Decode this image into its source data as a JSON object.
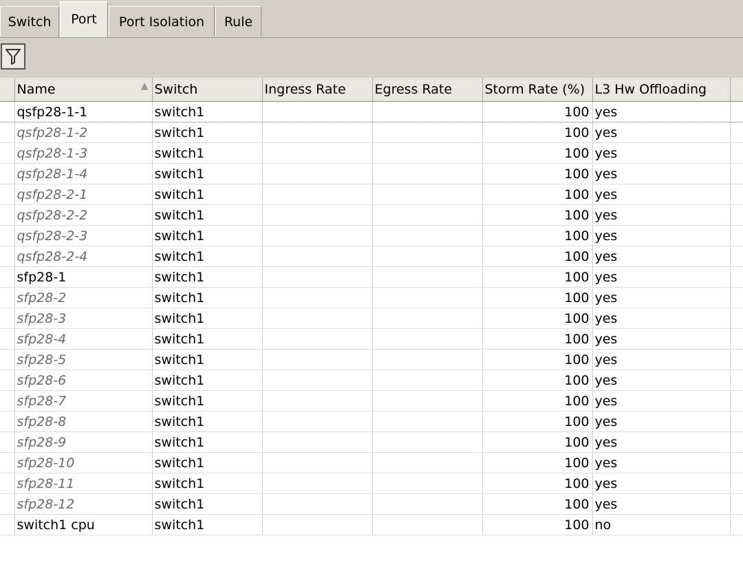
{
  "tabs": [
    {
      "label": "Switch",
      "active": false
    },
    {
      "label": "Port",
      "active": true
    },
    {
      "label": "Port Isolation",
      "active": false
    },
    {
      "label": "Rule",
      "active": false
    }
  ],
  "toolbar": {
    "filter_icon": "filter-icon"
  },
  "table": {
    "columns": [
      "Name",
      "Switch",
      "Ingress Rate",
      "Egress Rate",
      "Storm Rate (%)",
      "L3 Hw Offloading"
    ],
    "sort_indicator": "▲",
    "rows": [
      {
        "name": "qsfp28-1-1",
        "switch": "switch1",
        "ingress": "",
        "egress": "",
        "storm": "100",
        "l3": "yes",
        "disabled": false
      },
      {
        "name": "qsfp28-1-2",
        "switch": "switch1",
        "ingress": "",
        "egress": "",
        "storm": "100",
        "l3": "yes",
        "disabled": true
      },
      {
        "name": "qsfp28-1-3",
        "switch": "switch1",
        "ingress": "",
        "egress": "",
        "storm": "100",
        "l3": "yes",
        "disabled": true
      },
      {
        "name": "qsfp28-1-4",
        "switch": "switch1",
        "ingress": "",
        "egress": "",
        "storm": "100",
        "l3": "yes",
        "disabled": true
      },
      {
        "name": "qsfp28-2-1",
        "switch": "switch1",
        "ingress": "",
        "egress": "",
        "storm": "100",
        "l3": "yes",
        "disabled": true
      },
      {
        "name": "qsfp28-2-2",
        "switch": "switch1",
        "ingress": "",
        "egress": "",
        "storm": "100",
        "l3": "yes",
        "disabled": true
      },
      {
        "name": "qsfp28-2-3",
        "switch": "switch1",
        "ingress": "",
        "egress": "",
        "storm": "100",
        "l3": "yes",
        "disabled": true
      },
      {
        "name": "qsfp28-2-4",
        "switch": "switch1",
        "ingress": "",
        "egress": "",
        "storm": "100",
        "l3": "yes",
        "disabled": true
      },
      {
        "name": "sfp28-1",
        "switch": "switch1",
        "ingress": "",
        "egress": "",
        "storm": "100",
        "l3": "yes",
        "disabled": false
      },
      {
        "name": "sfp28-2",
        "switch": "switch1",
        "ingress": "",
        "egress": "",
        "storm": "100",
        "l3": "yes",
        "disabled": true
      },
      {
        "name": "sfp28-3",
        "switch": "switch1",
        "ingress": "",
        "egress": "",
        "storm": "100",
        "l3": "yes",
        "disabled": true
      },
      {
        "name": "sfp28-4",
        "switch": "switch1",
        "ingress": "",
        "egress": "",
        "storm": "100",
        "l3": "yes",
        "disabled": true
      },
      {
        "name": "sfp28-5",
        "switch": "switch1",
        "ingress": "",
        "egress": "",
        "storm": "100",
        "l3": "yes",
        "disabled": true
      },
      {
        "name": "sfp28-6",
        "switch": "switch1",
        "ingress": "",
        "egress": "",
        "storm": "100",
        "l3": "yes",
        "disabled": true
      },
      {
        "name": "sfp28-7",
        "switch": "switch1",
        "ingress": "",
        "egress": "",
        "storm": "100",
        "l3": "yes",
        "disabled": true
      },
      {
        "name": "sfp28-8",
        "switch": "switch1",
        "ingress": "",
        "egress": "",
        "storm": "100",
        "l3": "yes",
        "disabled": true
      },
      {
        "name": "sfp28-9",
        "switch": "switch1",
        "ingress": "",
        "egress": "",
        "storm": "100",
        "l3": "yes",
        "disabled": true
      },
      {
        "name": "sfp28-10",
        "switch": "switch1",
        "ingress": "",
        "egress": "",
        "storm": "100",
        "l3": "yes",
        "disabled": true
      },
      {
        "name": "sfp28-11",
        "switch": "switch1",
        "ingress": "",
        "egress": "",
        "storm": "100",
        "l3": "yes",
        "disabled": true
      },
      {
        "name": "sfp28-12",
        "switch": "switch1",
        "ingress": "",
        "egress": "",
        "storm": "100",
        "l3": "yes",
        "disabled": true
      },
      {
        "name": "switch1 cpu",
        "switch": "switch1",
        "ingress": "",
        "egress": "",
        "storm": "100",
        "l3": "no",
        "disabled": false
      }
    ]
  }
}
